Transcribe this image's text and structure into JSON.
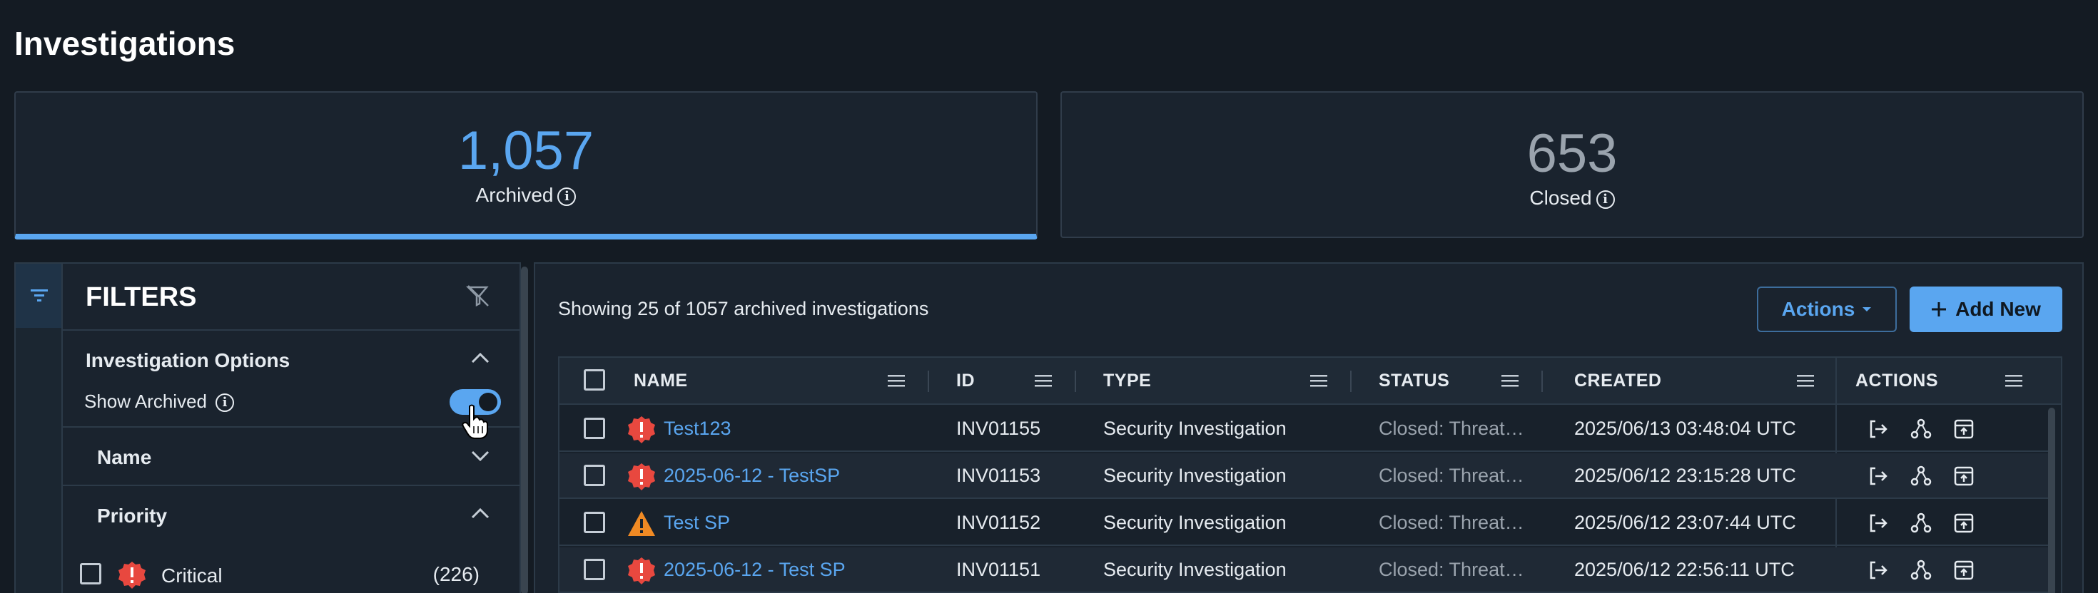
{
  "page": {
    "title": "Investigations"
  },
  "stats": {
    "archived": {
      "value": "1,057",
      "label": "Archived"
    },
    "closed": {
      "value": "653",
      "label": "Closed"
    }
  },
  "filters": {
    "title": "FILTERS",
    "investigation_options": "Investigation Options",
    "show_archived_label": "Show Archived",
    "show_archived": true,
    "name_section": "Name",
    "priority_section": "Priority",
    "priority_items": [
      {
        "label": "Critical",
        "count": "(226)"
      }
    ]
  },
  "main": {
    "showing_text": "Showing 25 of 1057 archived investigations",
    "actions_label": "Actions",
    "add_new_label": "Add New",
    "columns": {
      "name": "NAME",
      "id": "ID",
      "type": "TYPE",
      "status": "STATUS",
      "created": "CREATED",
      "actions": "ACTIONS"
    },
    "rows": [
      {
        "priority": "critical",
        "name": "Test123",
        "id": "INV01155",
        "type": "Security Investigation",
        "status": "Closed: Threat…",
        "created": "2025/06/13 03:48:04 UTC"
      },
      {
        "priority": "critical",
        "name": "2025-06-12 - TestSP",
        "id": "INV01153",
        "type": "Security Investigation",
        "status": "Closed: Threat…",
        "created": "2025/06/12 23:15:28 UTC"
      },
      {
        "priority": "high",
        "name": "Test SP",
        "id": "INV01152",
        "type": "Security Investigation",
        "status": "Closed: Threat…",
        "created": "2025/06/12 23:07:44 UTC"
      },
      {
        "priority": "critical",
        "name": "2025-06-12 - Test SP",
        "id": "INV01151",
        "type": "Security Investigation",
        "status": "Closed: Threat…",
        "created": "2025/06/12 22:56:11 UTC"
      }
    ]
  },
  "colors": {
    "accent": "#5aa6f0",
    "critical": "#e8483f",
    "high": "#f08a24",
    "background": "#141b23"
  }
}
